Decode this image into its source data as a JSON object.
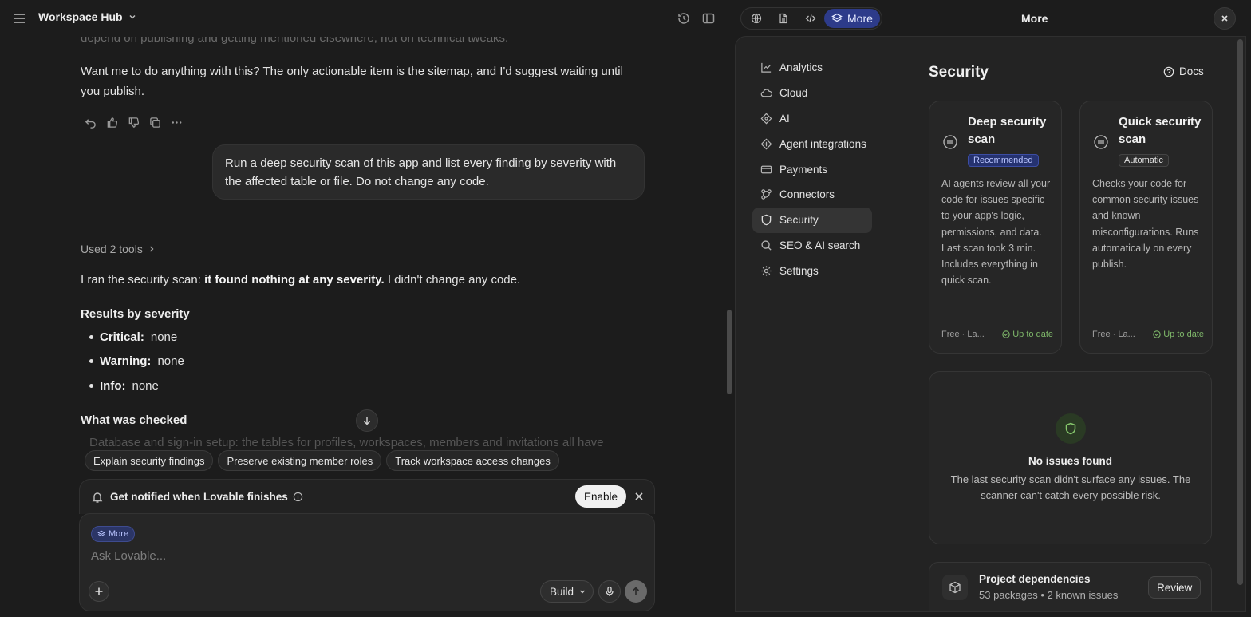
{
  "header": {
    "project_title": "Workspace Hub",
    "panel_title": "More",
    "active_tab_label": "More"
  },
  "chat": {
    "faded_top_line": "depend on publishing and getting mentioned elsewhere, not on technical tweaks.",
    "assistant_question": "Want me to do anything with this? The only actionable item is the sitemap, and I'd suggest waiting until you publish.",
    "user_message": "Run a deep security scan of this app and list every finding by severity with the affected table or file. Do not change any code.",
    "used_tools": "Used 2 tools",
    "summary_prefix": "I ran the security scan: ",
    "summary_bold": "it found nothing at any severity.",
    "summary_suffix": " I didn't change any code.",
    "results_heading": "Results by severity",
    "results": [
      {
        "label": "Critical:",
        "value": "none"
      },
      {
        "label": "Warning:",
        "value": "none"
      },
      {
        "label": "Info:",
        "value": "none"
      }
    ],
    "checked_heading": "What was checked",
    "faded_bullet_label": "Database and sign-in setup:",
    "faded_bullet_text": " the tables for profiles, workspaces, members and invitations all have"
  },
  "suggestions": [
    "Explain security findings",
    "Preserve existing member roles",
    "Track workspace access changes"
  ],
  "notify": {
    "text": "Get notified when Lovable finishes",
    "enable_label": "Enable"
  },
  "composer": {
    "badge": "More",
    "placeholder": "Ask Lovable...",
    "mode": "Build"
  },
  "nav": {
    "items": [
      {
        "label": "Analytics",
        "icon": "chart-icon"
      },
      {
        "label": "Cloud",
        "icon": "cloud-icon"
      },
      {
        "label": "AI",
        "icon": "sparkle-icon"
      },
      {
        "label": "Agent integrations",
        "icon": "agent-icon"
      },
      {
        "label": "Payments",
        "icon": "card-icon"
      },
      {
        "label": "Connectors",
        "icon": "connectors-icon"
      },
      {
        "label": "Security",
        "icon": "shield-icon",
        "active": true
      },
      {
        "label": "SEO & AI search",
        "icon": "search-icon"
      },
      {
        "label": "Settings",
        "icon": "gear-icon"
      }
    ]
  },
  "security": {
    "title": "Security",
    "docs_label": "Docs",
    "cards": [
      {
        "title": "Deep security scan",
        "badge": "Recommended",
        "description": "AI agents review all your code for issues specific to your app's logic, permissions, and data. Last scan took 3 min. Includes everything in quick scan.",
        "footer_left": "Free · La...",
        "footer_status": "Up to date"
      },
      {
        "title": "Quick security scan",
        "badge": "Automatic",
        "description": "Checks your code for common security issues and known misconfigurations. Runs automatically on every publish.",
        "footer_left": "Free · La...",
        "footer_status": "Up to date"
      }
    ],
    "no_issues_title": "No issues found",
    "no_issues_desc": "The last security scan didn't surface any issues. The scanner can't catch every possible risk.",
    "deps_title": "Project dependencies",
    "deps_sub": "53 packages • 2 known issues",
    "review_label": "Review"
  },
  "colors": {
    "accent": "#2d3b8a",
    "success": "#7fb86a",
    "background": "#1c1c1c",
    "panel": "#232323"
  }
}
